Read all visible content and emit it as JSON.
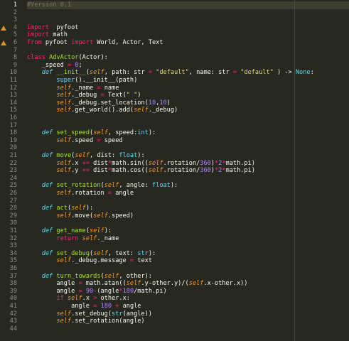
{
  "editor": {
    "lines": [
      {
        "n": "1",
        "t": [
          [
            "c",
            "#Version 0.1"
          ]
        ]
      },
      {
        "n": "2",
        "t": []
      },
      {
        "n": "3",
        "t": []
      },
      {
        "n": "4",
        "warn": true,
        "t": [
          [
            "k",
            "import"
          ],
          [
            "",
            "  pyfoot"
          ]
        ]
      },
      {
        "n": "5",
        "t": [
          [
            "k",
            "import"
          ],
          [
            "",
            " math"
          ]
        ]
      },
      {
        "n": "6",
        "warn": true,
        "t": [
          [
            "k",
            "from"
          ],
          [
            "",
            " pyfoot "
          ],
          [
            "k",
            "import"
          ],
          [
            "",
            " World, Actor, Text"
          ]
        ]
      },
      {
        "n": "7",
        "t": []
      },
      {
        "n": "8",
        "t": [
          [
            "k",
            "class"
          ],
          [
            "",
            " "
          ],
          [
            "f",
            "AdvActor"
          ],
          [
            "",
            "(Actor):"
          ]
        ]
      },
      {
        "n": "9",
        "t": [
          [
            "",
            "    _speed "
          ],
          [
            "k",
            "="
          ],
          [
            "",
            " "
          ],
          [
            "n",
            "0"
          ],
          [
            "",
            ";"
          ]
        ]
      },
      {
        "n": "10",
        "t": [
          [
            "",
            "    "
          ],
          [
            "d",
            "def"
          ],
          [
            "",
            " "
          ],
          [
            "f",
            "__init__"
          ],
          [
            "",
            "("
          ],
          [
            "p",
            "self"
          ],
          [
            "",
            ", path: str "
          ],
          [
            "k",
            "="
          ],
          [
            "",
            " "
          ],
          [
            "s",
            "\"default\""
          ],
          [
            "",
            ", name: str "
          ],
          [
            "k",
            "="
          ],
          [
            "",
            " "
          ],
          [
            "s",
            "\"default\""
          ],
          [
            "",
            " ) -> "
          ],
          [
            "b",
            "None"
          ],
          [
            "",
            ":"
          ]
        ]
      },
      {
        "n": "11",
        "t": [
          [
            "",
            "        "
          ],
          [
            "b",
            "super"
          ],
          [
            "",
            "().__init__(path)"
          ]
        ]
      },
      {
        "n": "12",
        "t": [
          [
            "",
            "        "
          ],
          [
            "p",
            "self"
          ],
          [
            "",
            "._name "
          ],
          [
            "k",
            "="
          ],
          [
            "",
            " name"
          ]
        ]
      },
      {
        "n": "13",
        "t": [
          [
            "",
            "        "
          ],
          [
            "p",
            "self"
          ],
          [
            "",
            "._debug "
          ],
          [
            "k",
            "="
          ],
          [
            "",
            " Text("
          ],
          [
            "s",
            "\" \""
          ],
          [
            "",
            ")"
          ]
        ]
      },
      {
        "n": "14",
        "t": [
          [
            "",
            "        "
          ],
          [
            "p",
            "self"
          ],
          [
            "",
            "._debug.set_location("
          ],
          [
            "n",
            "10"
          ],
          [
            "",
            ","
          ],
          [
            "n",
            "10"
          ],
          [
            "",
            ")"
          ]
        ]
      },
      {
        "n": "15",
        "t": [
          [
            "",
            "        "
          ],
          [
            "p",
            "self"
          ],
          [
            "",
            ".get_world().add("
          ],
          [
            "p",
            "self"
          ],
          [
            "",
            "._debug)"
          ]
        ]
      },
      {
        "n": "16",
        "t": []
      },
      {
        "n": "17",
        "t": []
      },
      {
        "n": "18",
        "t": [
          [
            "",
            "    "
          ],
          [
            "d",
            "def"
          ],
          [
            "",
            " "
          ],
          [
            "f",
            "set_speed"
          ],
          [
            "",
            "("
          ],
          [
            "p",
            "self"
          ],
          [
            "",
            ", speed:"
          ],
          [
            "b",
            "int"
          ],
          [
            "",
            "):"
          ]
        ]
      },
      {
        "n": "19",
        "t": [
          [
            "",
            "        "
          ],
          [
            "p",
            "self"
          ],
          [
            "",
            ".speed "
          ],
          [
            "k",
            "="
          ],
          [
            "",
            " speed"
          ]
        ]
      },
      {
        "n": "20",
        "t": []
      },
      {
        "n": "21",
        "t": [
          [
            "",
            "    "
          ],
          [
            "d",
            "def"
          ],
          [
            "",
            " "
          ],
          [
            "f",
            "move"
          ],
          [
            "",
            "("
          ],
          [
            "p",
            "self"
          ],
          [
            "",
            ", dist: "
          ],
          [
            "b",
            "float"
          ],
          [
            "",
            "):"
          ]
        ]
      },
      {
        "n": "22",
        "t": [
          [
            "",
            "        "
          ],
          [
            "p",
            "self"
          ],
          [
            "",
            ".x "
          ],
          [
            "k",
            "+="
          ],
          [
            "",
            " dist"
          ],
          [
            "k",
            "*"
          ],
          [
            "",
            "math.sin(("
          ],
          [
            "p",
            "self"
          ],
          [
            "",
            ".rotation/"
          ],
          [
            "n",
            "360"
          ],
          [
            "",
            ")"
          ],
          [
            "k",
            "*"
          ],
          [
            "n",
            "2"
          ],
          [
            "k",
            "*"
          ],
          [
            "",
            "math.pi)"
          ]
        ]
      },
      {
        "n": "23",
        "t": [
          [
            "",
            "        "
          ],
          [
            "p",
            "self"
          ],
          [
            "",
            ".y "
          ],
          [
            "k",
            "+="
          ],
          [
            "",
            " dist"
          ],
          [
            "k",
            "*"
          ],
          [
            "",
            "math.cos(("
          ],
          [
            "p",
            "self"
          ],
          [
            "",
            ".rotation/"
          ],
          [
            "n",
            "360"
          ],
          [
            "",
            ")"
          ],
          [
            "k",
            "*"
          ],
          [
            "n",
            "2"
          ],
          [
            "k",
            "*"
          ],
          [
            "",
            "math.pi)"
          ]
        ]
      },
      {
        "n": "24",
        "t": []
      },
      {
        "n": "25",
        "t": [
          [
            "",
            "    "
          ],
          [
            "d",
            "def"
          ],
          [
            "",
            " "
          ],
          [
            "f",
            "set_rotation"
          ],
          [
            "",
            "("
          ],
          [
            "p",
            "self"
          ],
          [
            "",
            ", angle: "
          ],
          [
            "b",
            "float"
          ],
          [
            "",
            "):"
          ]
        ]
      },
      {
        "n": "26",
        "t": [
          [
            "",
            "        "
          ],
          [
            "p",
            "self"
          ],
          [
            "",
            ".rotation "
          ],
          [
            "k",
            "="
          ],
          [
            "",
            " angle"
          ]
        ]
      },
      {
        "n": "27",
        "t": []
      },
      {
        "n": "28",
        "t": [
          [
            "",
            "    "
          ],
          [
            "d",
            "def"
          ],
          [
            "",
            " "
          ],
          [
            "f",
            "act"
          ],
          [
            "",
            "("
          ],
          [
            "p",
            "self"
          ],
          [
            "",
            "):"
          ]
        ]
      },
      {
        "n": "29",
        "t": [
          [
            "",
            "        "
          ],
          [
            "p",
            "self"
          ],
          [
            "",
            ".move("
          ],
          [
            "p",
            "self"
          ],
          [
            "",
            ".speed)"
          ]
        ]
      },
      {
        "n": "30",
        "t": []
      },
      {
        "n": "31",
        "t": [
          [
            "",
            "    "
          ],
          [
            "d",
            "def"
          ],
          [
            "",
            " "
          ],
          [
            "f",
            "get_name"
          ],
          [
            "",
            "("
          ],
          [
            "p",
            "self"
          ],
          [
            "",
            "):"
          ]
        ]
      },
      {
        "n": "32",
        "t": [
          [
            "",
            "        "
          ],
          [
            "k",
            "return"
          ],
          [
            "",
            " "
          ],
          [
            "p",
            "self"
          ],
          [
            "",
            "._name"
          ]
        ]
      },
      {
        "n": "33",
        "t": []
      },
      {
        "n": "34",
        "t": [
          [
            "",
            "    "
          ],
          [
            "d",
            "def"
          ],
          [
            "",
            " "
          ],
          [
            "f",
            "set_debug"
          ],
          [
            "",
            "("
          ],
          [
            "p",
            "self"
          ],
          [
            "",
            ", text: "
          ],
          [
            "b",
            "str"
          ],
          [
            "",
            "):"
          ]
        ]
      },
      {
        "n": "35",
        "t": [
          [
            "",
            "        "
          ],
          [
            "p",
            "self"
          ],
          [
            "",
            "._debug.message "
          ],
          [
            "k",
            "="
          ],
          [
            "",
            " text"
          ]
        ]
      },
      {
        "n": "36",
        "t": []
      },
      {
        "n": "37",
        "t": [
          [
            "",
            "    "
          ],
          [
            "d",
            "def"
          ],
          [
            "",
            " "
          ],
          [
            "f",
            "turn_towards"
          ],
          [
            "",
            "("
          ],
          [
            "p",
            "self"
          ],
          [
            "",
            ", other):"
          ]
        ]
      },
      {
        "n": "38",
        "t": [
          [
            "",
            "        angle "
          ],
          [
            "k",
            "="
          ],
          [
            "",
            " math.atan(("
          ],
          [
            "p",
            "self"
          ],
          [
            "",
            ".y-other.y)/("
          ],
          [
            "p",
            "self"
          ],
          [
            "",
            ".x-other.x))"
          ]
        ]
      },
      {
        "n": "39",
        "t": [
          [
            "",
            "        angle "
          ],
          [
            "k",
            "="
          ],
          [
            "",
            " "
          ],
          [
            "n",
            "90"
          ],
          [
            "k",
            "-"
          ],
          [
            "",
            "(angle"
          ],
          [
            "k",
            "*"
          ],
          [
            "n",
            "180"
          ],
          [
            "",
            "/math.pi)"
          ]
        ]
      },
      {
        "n": "40",
        "t": [
          [
            "",
            "        "
          ],
          [
            "k",
            "if"
          ],
          [
            "",
            " "
          ],
          [
            "p",
            "self"
          ],
          [
            "",
            ".x "
          ],
          [
            "k",
            ">"
          ],
          [
            "",
            " other.x:"
          ]
        ]
      },
      {
        "n": "41",
        "t": [
          [
            "",
            "            angle "
          ],
          [
            "k",
            "="
          ],
          [
            "",
            " "
          ],
          [
            "n",
            "180"
          ],
          [
            "",
            " "
          ],
          [
            "k",
            "+"
          ],
          [
            "",
            " angle"
          ]
        ]
      },
      {
        "n": "42",
        "t": [
          [
            "",
            "        "
          ],
          [
            "p",
            "self"
          ],
          [
            "",
            ".set_debug("
          ],
          [
            "b",
            "str"
          ],
          [
            "",
            "(angle))"
          ]
        ]
      },
      {
        "n": "43",
        "t": [
          [
            "",
            "        "
          ],
          [
            "p",
            "self"
          ],
          [
            "",
            ".set_rotation(angle)"
          ]
        ]
      },
      {
        "n": "44",
        "t": []
      }
    ]
  }
}
